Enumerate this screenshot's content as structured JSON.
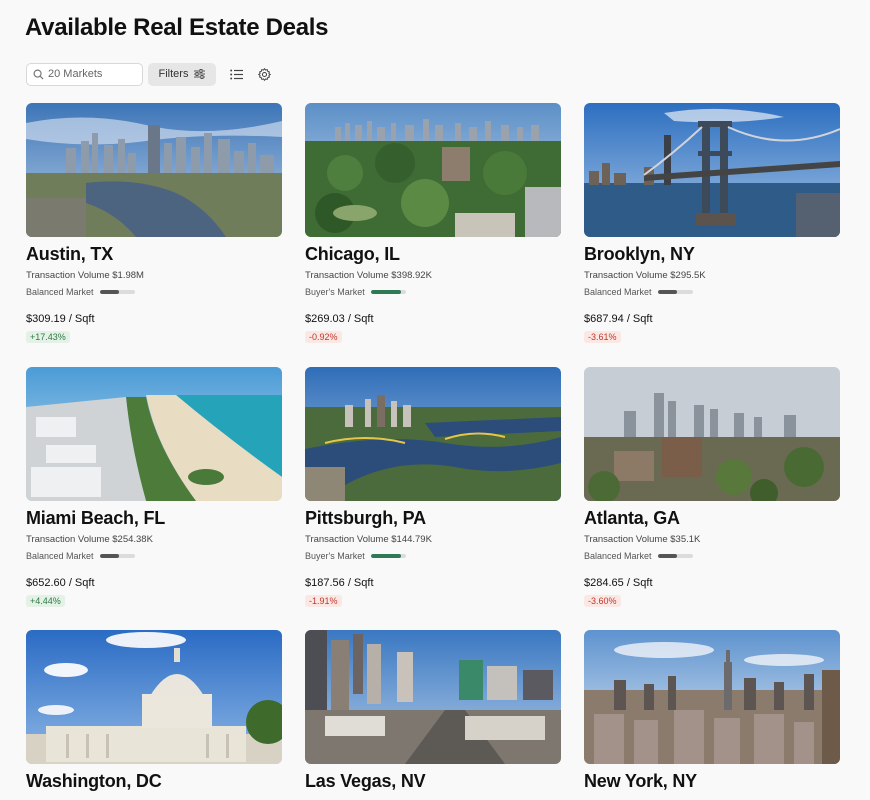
{
  "page": {
    "title": "Available Real Estate Deals"
  },
  "toolbar": {
    "search_placeholder": "20 Markets",
    "filters_label": "Filters",
    "list_view_icon": "list-icon",
    "settings_icon": "gear-icon"
  },
  "colors": {
    "balanced": "#555555",
    "buyers": "#2f7a55",
    "up_bg": "#e3f1e6",
    "up_fg": "#2f7a45",
    "down_bg": "#fbe7e4",
    "down_fg": "#c0392b"
  },
  "deals": [
    {
      "city": "Austin, TX",
      "volume": "Transaction Volume $1.98M",
      "market": "Balanced Market",
      "market_type": "balanced",
      "market_level": 0.55,
      "price": "$309.19 / Sqft",
      "change": "+17.43%",
      "direction": "up",
      "photo": "city-skyline-river"
    },
    {
      "city": "Chicago, IL",
      "volume": "Transaction Volume $398.92K",
      "market": "Buyer's Market",
      "market_type": "buyers",
      "market_level": 0.85,
      "price": "$269.03 / Sqft",
      "change": "-0.92%",
      "direction": "down",
      "photo": "park-skyline"
    },
    {
      "city": "Brooklyn, NY",
      "volume": "Transaction Volume $295.5K",
      "market": "Balanced Market",
      "market_type": "balanced",
      "market_level": 0.55,
      "price": "$687.94 / Sqft",
      "change": "-3.61%",
      "direction": "down",
      "photo": "bridge"
    },
    {
      "city": "Miami Beach, FL",
      "volume": "Transaction Volume $254.38K",
      "market": "Balanced Market",
      "market_type": "balanced",
      "market_level": 0.55,
      "price": "$652.60 / Sqft",
      "change": "+4.44%",
      "direction": "up",
      "photo": "beach"
    },
    {
      "city": "Pittsburgh, PA",
      "volume": "Transaction Volume $144.79K",
      "market": "Buyer's Market",
      "market_type": "buyers",
      "market_level": 0.85,
      "price": "$187.56 / Sqft",
      "change": "-1.91%",
      "direction": "down",
      "photo": "rivers-city"
    },
    {
      "city": "Atlanta, GA",
      "volume": "Transaction Volume $35.1K",
      "market": "Balanced Market",
      "market_type": "balanced",
      "market_level": 0.55,
      "price": "$284.65 / Sqft",
      "change": "-3.60%",
      "direction": "down",
      "photo": "hazy-skyline"
    },
    {
      "city": "Washington, DC",
      "photo": "capitol"
    },
    {
      "city": "Las Vegas, NV",
      "photo": "strip"
    },
    {
      "city": "New York, NY",
      "photo": "manhattan"
    }
  ]
}
